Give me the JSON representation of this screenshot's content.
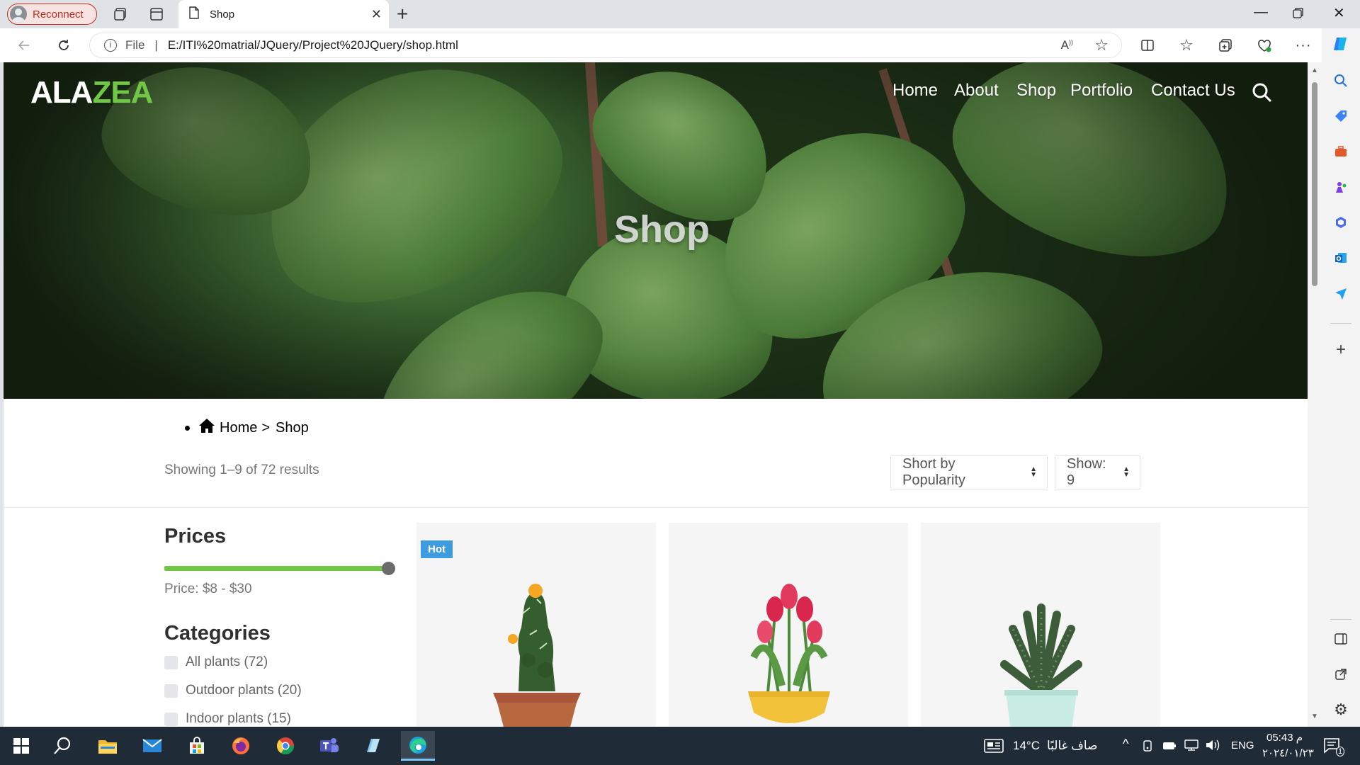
{
  "browser": {
    "reconnect_label": "Reconnect",
    "tab_title": "Shop",
    "file_label": "File",
    "url": "E:/ITI%20matrial/JQuery/Project%20JQuery/shop.html"
  },
  "site": {
    "logo_part1": "ALA",
    "logo_part2": "ZEA",
    "nav": [
      "Home",
      "About",
      "Shop",
      "Portfolio",
      "Contact Us"
    ],
    "hero_title": "Shop"
  },
  "breadcrumb": {
    "home": "Home",
    "separator": ">",
    "current": "Shop"
  },
  "toolbar": {
    "results_text": "Showing 1–9 of 72 results",
    "sort_label": "Short by Popularity",
    "show_label": "Show: 9"
  },
  "sidebar": {
    "prices_heading": "Prices",
    "price_text": "Price: $8 - $30",
    "price_range_fraction": 1.0,
    "categories_heading": "Categories",
    "categories": [
      "All plants (72)",
      "Outdoor plants (20)",
      "Indoor plants (15)"
    ]
  },
  "products": [
    {
      "badge": "Hot",
      "plant": "cactus-in-terracotta-pot"
    },
    {
      "badge": "",
      "plant": "red-tulips-in-yellow-pot"
    },
    {
      "badge": "",
      "plant": "succulent-in-mint-pot"
    }
  ],
  "taskbar": {
    "weather_temp": "14°C",
    "weather_text": "صاف غالبًا",
    "language": "ENG",
    "time": "05:43 م",
    "date": "٢٠٢٤/٠١/٢٣",
    "notification_count": "1"
  },
  "colors": {
    "accent_green": "#70c745",
    "hot_badge": "#3d9be0",
    "taskbar": "#1f2c37"
  }
}
